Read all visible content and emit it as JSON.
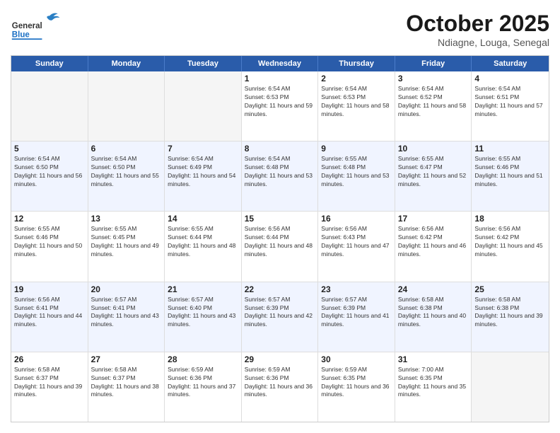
{
  "header": {
    "logo_general": "General",
    "logo_blue": "Blue",
    "month_title": "October 2025",
    "subtitle": "Ndiagne, Louga, Senegal"
  },
  "days_of_week": [
    "Sunday",
    "Monday",
    "Tuesday",
    "Wednesday",
    "Thursday",
    "Friday",
    "Saturday"
  ],
  "weeks": [
    [
      {
        "day": "",
        "empty": true
      },
      {
        "day": "",
        "empty": true
      },
      {
        "day": "",
        "empty": true
      },
      {
        "day": "1",
        "sunrise": "6:54 AM",
        "sunset": "6:53 PM",
        "daylight": "11 hours and 59 minutes."
      },
      {
        "day": "2",
        "sunrise": "6:54 AM",
        "sunset": "6:53 PM",
        "daylight": "11 hours and 58 minutes."
      },
      {
        "day": "3",
        "sunrise": "6:54 AM",
        "sunset": "6:52 PM",
        "daylight": "11 hours and 58 minutes."
      },
      {
        "day": "4",
        "sunrise": "6:54 AM",
        "sunset": "6:51 PM",
        "daylight": "11 hours and 57 minutes."
      }
    ],
    [
      {
        "day": "5",
        "sunrise": "6:54 AM",
        "sunset": "6:50 PM",
        "daylight": "11 hours and 56 minutes."
      },
      {
        "day": "6",
        "sunrise": "6:54 AM",
        "sunset": "6:50 PM",
        "daylight": "11 hours and 55 minutes."
      },
      {
        "day": "7",
        "sunrise": "6:54 AM",
        "sunset": "6:49 PM",
        "daylight": "11 hours and 54 minutes."
      },
      {
        "day": "8",
        "sunrise": "6:54 AM",
        "sunset": "6:48 PM",
        "daylight": "11 hours and 53 minutes."
      },
      {
        "day": "9",
        "sunrise": "6:55 AM",
        "sunset": "6:48 PM",
        "daylight": "11 hours and 53 minutes."
      },
      {
        "day": "10",
        "sunrise": "6:55 AM",
        "sunset": "6:47 PM",
        "daylight": "11 hours and 52 minutes."
      },
      {
        "day": "11",
        "sunrise": "6:55 AM",
        "sunset": "6:46 PM",
        "daylight": "11 hours and 51 minutes."
      }
    ],
    [
      {
        "day": "12",
        "sunrise": "6:55 AM",
        "sunset": "6:46 PM",
        "daylight": "11 hours and 50 minutes."
      },
      {
        "day": "13",
        "sunrise": "6:55 AM",
        "sunset": "6:45 PM",
        "daylight": "11 hours and 49 minutes."
      },
      {
        "day": "14",
        "sunrise": "6:55 AM",
        "sunset": "6:44 PM",
        "daylight": "11 hours and 48 minutes."
      },
      {
        "day": "15",
        "sunrise": "6:56 AM",
        "sunset": "6:44 PM",
        "daylight": "11 hours and 48 minutes."
      },
      {
        "day": "16",
        "sunrise": "6:56 AM",
        "sunset": "6:43 PM",
        "daylight": "11 hours and 47 minutes."
      },
      {
        "day": "17",
        "sunrise": "6:56 AM",
        "sunset": "6:42 PM",
        "daylight": "11 hours and 46 minutes."
      },
      {
        "day": "18",
        "sunrise": "6:56 AM",
        "sunset": "6:42 PM",
        "daylight": "11 hours and 45 minutes."
      }
    ],
    [
      {
        "day": "19",
        "sunrise": "6:56 AM",
        "sunset": "6:41 PM",
        "daylight": "11 hours and 44 minutes."
      },
      {
        "day": "20",
        "sunrise": "6:57 AM",
        "sunset": "6:41 PM",
        "daylight": "11 hours and 43 minutes."
      },
      {
        "day": "21",
        "sunrise": "6:57 AM",
        "sunset": "6:40 PM",
        "daylight": "11 hours and 43 minutes."
      },
      {
        "day": "22",
        "sunrise": "6:57 AM",
        "sunset": "6:39 PM",
        "daylight": "11 hours and 42 minutes."
      },
      {
        "day": "23",
        "sunrise": "6:57 AM",
        "sunset": "6:39 PM",
        "daylight": "11 hours and 41 minutes."
      },
      {
        "day": "24",
        "sunrise": "6:58 AM",
        "sunset": "6:38 PM",
        "daylight": "11 hours and 40 minutes."
      },
      {
        "day": "25",
        "sunrise": "6:58 AM",
        "sunset": "6:38 PM",
        "daylight": "11 hours and 39 minutes."
      }
    ],
    [
      {
        "day": "26",
        "sunrise": "6:58 AM",
        "sunset": "6:37 PM",
        "daylight": "11 hours and 39 minutes."
      },
      {
        "day": "27",
        "sunrise": "6:58 AM",
        "sunset": "6:37 PM",
        "daylight": "11 hours and 38 minutes."
      },
      {
        "day": "28",
        "sunrise": "6:59 AM",
        "sunset": "6:36 PM",
        "daylight": "11 hours and 37 minutes."
      },
      {
        "day": "29",
        "sunrise": "6:59 AM",
        "sunset": "6:36 PM",
        "daylight": "11 hours and 36 minutes."
      },
      {
        "day": "30",
        "sunrise": "6:59 AM",
        "sunset": "6:35 PM",
        "daylight": "11 hours and 36 minutes."
      },
      {
        "day": "31",
        "sunrise": "7:00 AM",
        "sunset": "6:35 PM",
        "daylight": "11 hours and 35 minutes."
      },
      {
        "day": "",
        "empty": true
      }
    ]
  ]
}
